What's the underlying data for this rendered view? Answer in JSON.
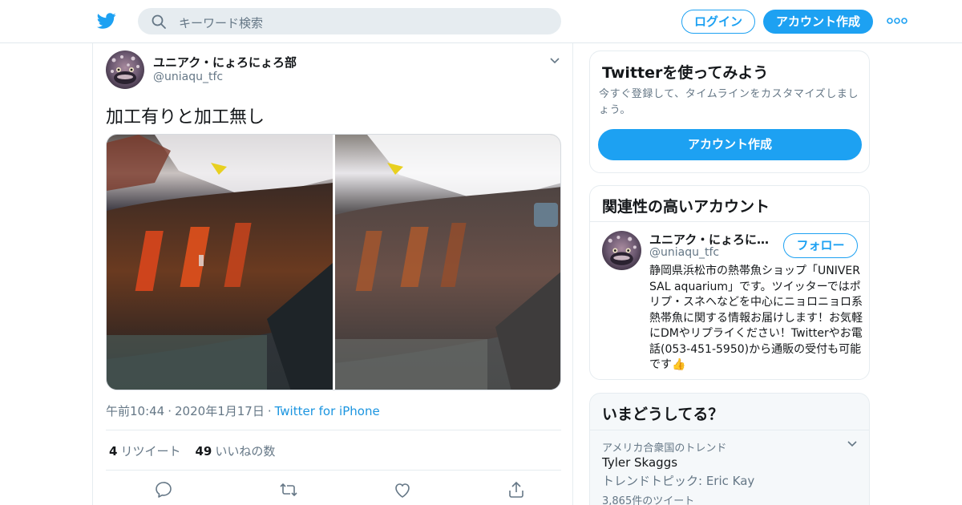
{
  "header": {
    "search_placeholder": "キーワード検索",
    "login_label": "ログイン",
    "signup_label": "アカウント作成",
    "brand_color": "#1da1f2"
  },
  "tweet": {
    "author_name": "ユニアク・にょろにょろ部",
    "author_handle": "@uniaqu_tfc",
    "text": "加工有りと加工無し",
    "time": "午前10:44",
    "date": "2020年1月17日",
    "source": "Twitter for iPhone",
    "retweets_count": "4",
    "retweets_label": "リツイート",
    "likes_count": "49",
    "likes_label": "いいねの数",
    "icons": [
      "reply-icon",
      "retweet-icon",
      "like-icon",
      "share-icon"
    ]
  },
  "sidebar": {
    "try_card": {
      "title": "Twitterを使ってみよう",
      "description": "今すぐ登録して、タイムラインをカスタマイズしましょう。",
      "signup_label": "アカウント作成"
    },
    "related": {
      "title": "関連性の高いアカウント",
      "name": "ユニアク・にょろにょろ部",
      "handle": "@uniaqu_tfc",
      "follow_label": "フォロー",
      "bio": "静岡県浜松市の熱帯魚ショップ「UNIVERSAL aquarium」です。ツイッターではポリプ・スネヘなどを中心にニョロニョロ系熱帯魚に関する情報お届けします！お気軽にDMやリプライください！Twitterやお電話(053-451-5950)から通販の受付も可能です👍"
    },
    "trends": {
      "title": "いまどうしてる？",
      "location": "アメリカ合衆国のトレンド",
      "trend_name": "Tyler Skaggs",
      "trend_topic": "トレンドトピック: Eric Kay",
      "tweet_count": "3,865件のツイート"
    }
  }
}
